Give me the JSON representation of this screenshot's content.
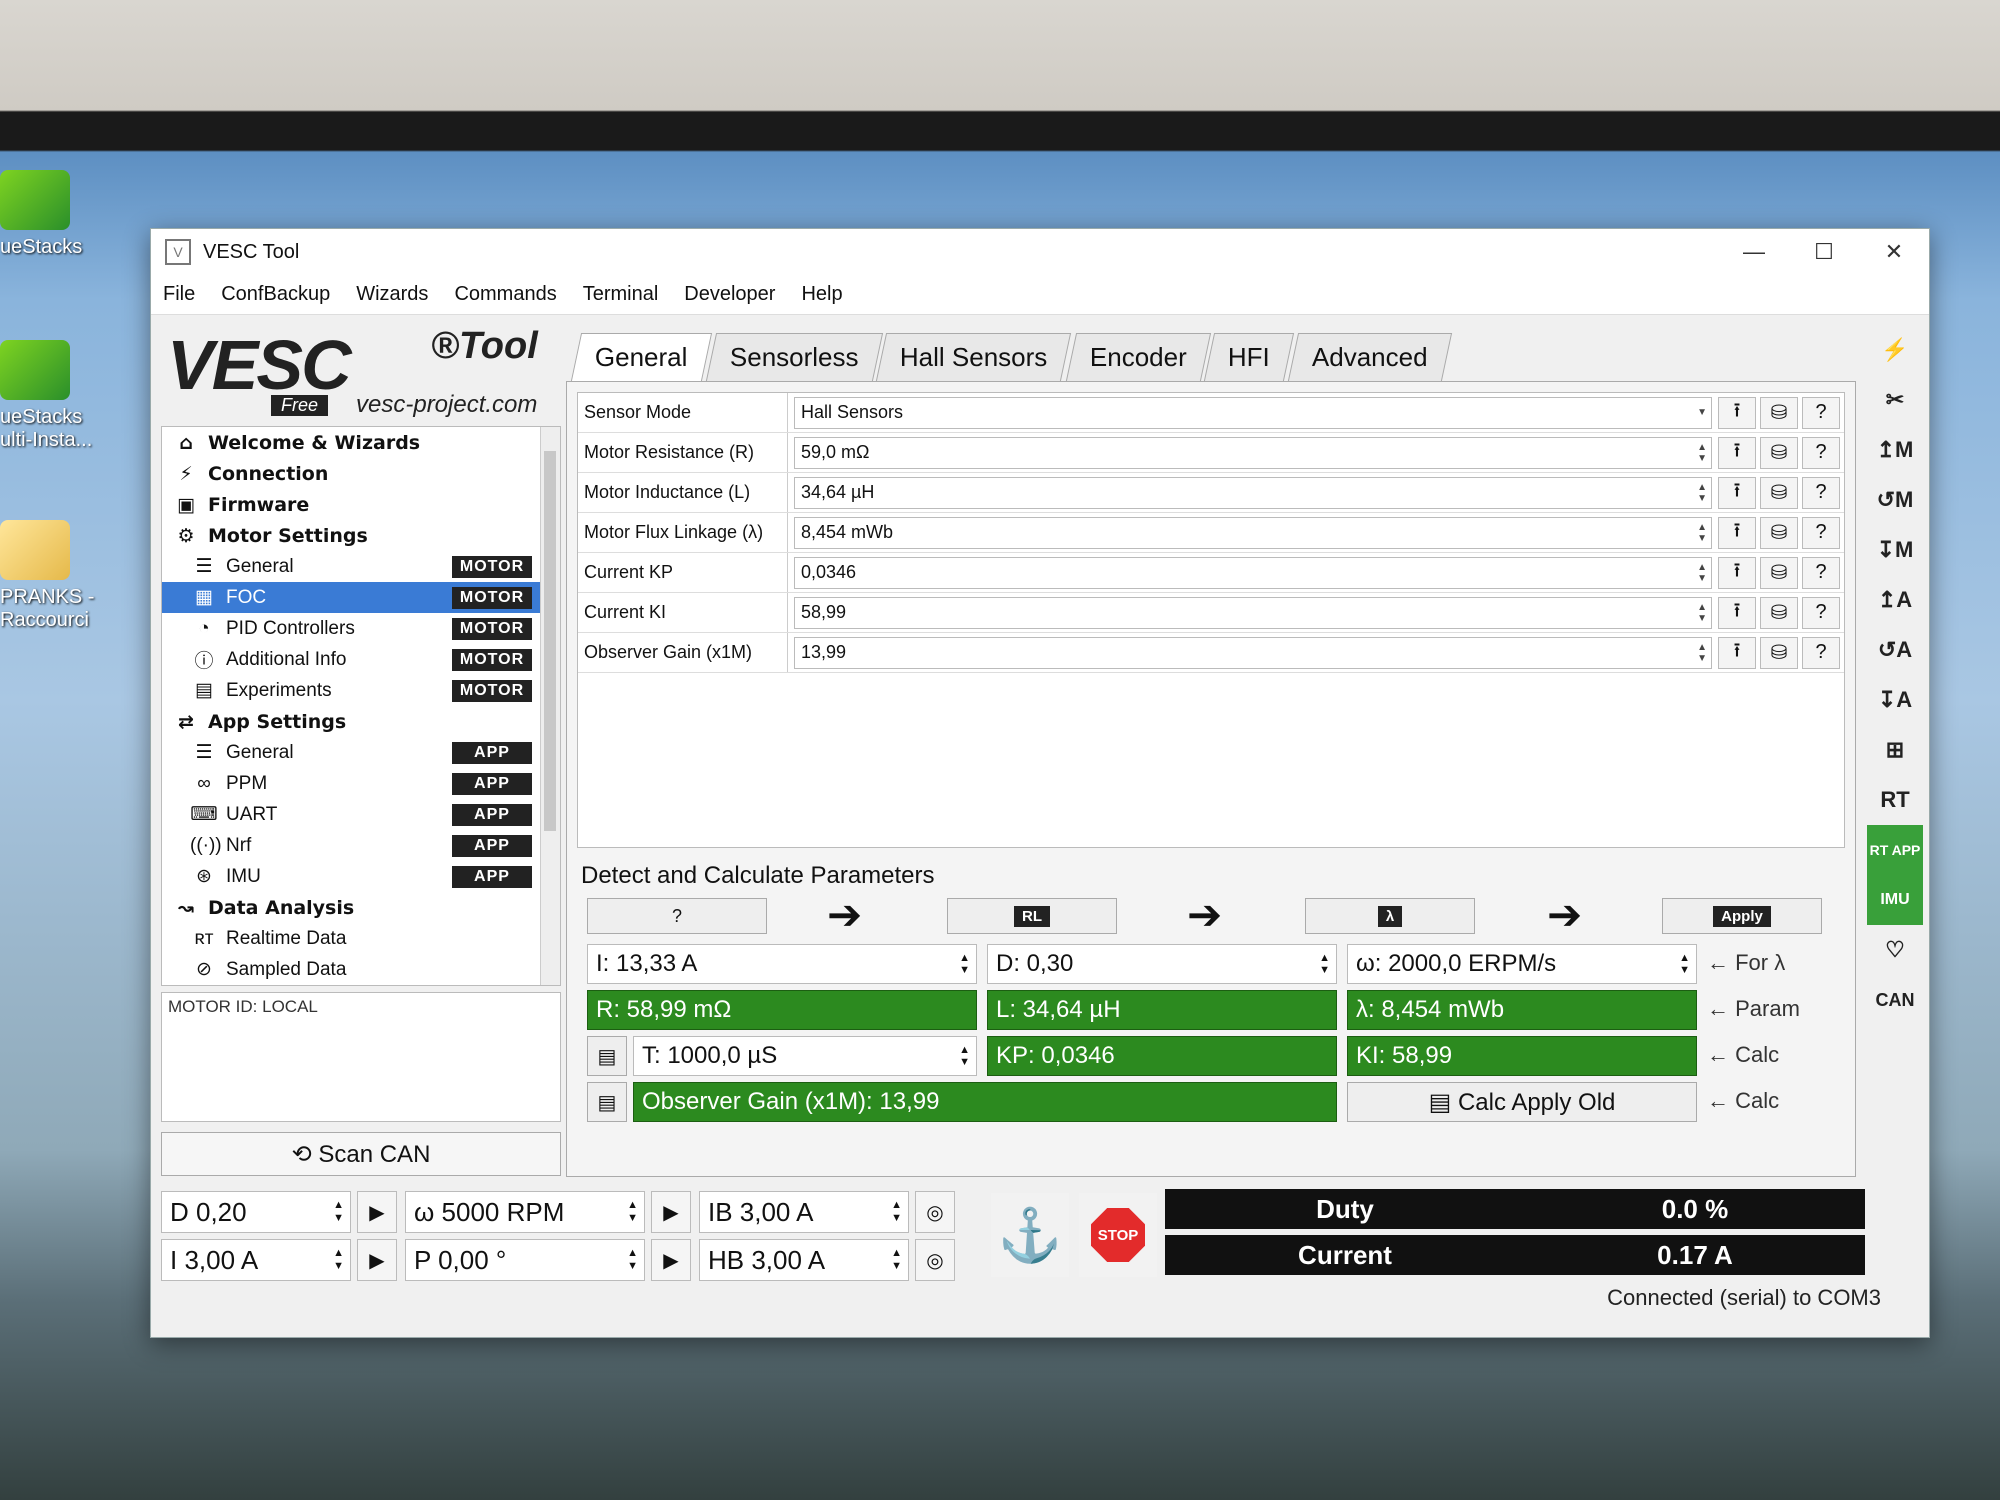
{
  "desktop": {
    "icons": [
      {
        "label": "ueStacks"
      },
      {
        "label": "ueStacks ulti-Insta..."
      },
      {
        "label": "PRANKS - Raccourci"
      }
    ]
  },
  "window": {
    "title": "VESC Tool",
    "controls": {
      "minimize": "—",
      "maximize": "☐",
      "close": "✕"
    }
  },
  "menu": [
    "File",
    "ConfBackup",
    "Wizards",
    "Commands",
    "Terminal",
    "Developer",
    "Help"
  ],
  "logo": {
    "main": "VESC",
    "tool": "®Tool",
    "free": "Free",
    "site": "vesc-project.com"
  },
  "sidebar": {
    "items": [
      {
        "label": "Welcome & Wizards",
        "icon": "home-icon",
        "glyph": "⌂"
      },
      {
        "label": "Connection",
        "icon": "plug-icon",
        "glyph": "⚡"
      },
      {
        "label": "Firmware",
        "icon": "chip-icon",
        "glyph": "▣"
      },
      {
        "label": "Motor Settings",
        "icon": "gear-icon",
        "glyph": "⚙"
      },
      {
        "label": "General",
        "icon": "sliders-icon",
        "glyph": "☰",
        "tag": "MOTOR"
      },
      {
        "label": "FOC",
        "icon": "foc-icon",
        "glyph": "▦",
        "tag": "MOTOR"
      },
      {
        "label": "PID Controllers",
        "icon": "gauge-icon",
        "glyph": "◔",
        "tag": "MOTOR"
      },
      {
        "label": "Additional Info",
        "icon": "info-icon",
        "glyph": "ⓘ",
        "tag": "MOTOR"
      },
      {
        "label": "Experiments",
        "icon": "calculator-icon",
        "glyph": "▤",
        "tag": "MOTOR"
      },
      {
        "label": "App Settings",
        "icon": "app-settings-icon",
        "glyph": "⇄"
      },
      {
        "label": "General",
        "icon": "sliders-icon",
        "glyph": "☰",
        "tag": "APP"
      },
      {
        "label": "PPM",
        "icon": "ppm-icon",
        "glyph": "∞",
        "tag": "APP"
      },
      {
        "label": "UART",
        "icon": "keyboard-icon",
        "glyph": "⌨",
        "tag": "APP"
      },
      {
        "label": "Nrf",
        "icon": "wireless-icon",
        "glyph": "((·))",
        "tag": "APP"
      },
      {
        "label": "IMU",
        "icon": "imu-icon",
        "glyph": "⊛",
        "tag": "APP"
      },
      {
        "label": "Data Analysis",
        "icon": "analysis-icon",
        "glyph": "↝"
      },
      {
        "label": "Realtime Data",
        "icon": "realtime-icon",
        "glyph": "ʀᴛ"
      },
      {
        "label": "Sampled Data",
        "icon": "sampled-icon",
        "glyph": "⊘"
      }
    ],
    "motor_id": "MOTOR ID: LOCAL",
    "scan_can": "⟲ Scan CAN"
  },
  "tabs": [
    "General",
    "Sensorless",
    "Hall Sensors",
    "Encoder",
    "HFI",
    "Advanced"
  ],
  "params": [
    {
      "label": "Sensor Mode",
      "value": "Hall Sensors",
      "type": "select"
    },
    {
      "label": "Motor Resistance (R)",
      "value": "59,0 mΩ",
      "type": "spin"
    },
    {
      "label": "Motor Inductance (L)",
      "value": "34,64 µH",
      "type": "spin"
    },
    {
      "label": "Motor Flux Linkage (λ)",
      "value": "8,454 mWb",
      "type": "spin"
    },
    {
      "label": "Current KP",
      "value": "0,0346",
      "type": "spin"
    },
    {
      "label": "Current KI",
      "value": "58,99",
      "type": "spin"
    },
    {
      "label": "Observer Gain (x1M)",
      "value": "13,99",
      "type": "spin"
    }
  ],
  "detect": {
    "title": "Detect and Calculate Parameters",
    "help_btn": "?",
    "rl_btn": "RL",
    "lambda_btn": "λ",
    "apply_btn": "Apply",
    "arrow": "➔",
    "i_input": "I: 13,33 A",
    "d_input": "D: 0,30",
    "w_input": "ω: 2000,0 ERPM/s",
    "r_result": "R: 58,99 mΩ",
    "l_result": "L: 34,64 µH",
    "lambda_result": "λ: 8,454 mWb",
    "t_input": "T: 1000,0 µS",
    "kp_result": "KP: 0,0346",
    "ki_result": "KI: 58,99",
    "observer_result": "Observer Gain (x1M): 13,99",
    "calc_apply_old": "▤ Calc Apply Old",
    "labels": [
      "← For λ",
      "← Param",
      "← Calc",
      "← Calc"
    ]
  },
  "bottom": {
    "d_value": "D 0,20",
    "i_value": "I 3,00 A",
    "rpm_value": "ω 5000 RPM",
    "p_value": "P 0,00 °",
    "ib_value": "IB 3,00 A",
    "hb_value": "HB 3,00 A",
    "stop_label": "STOP",
    "duty_label": "Duty",
    "duty_value": "0.0 %",
    "current_label": "Current",
    "current_value": "0.17 A",
    "status": "Connected (serial) to COM3"
  },
  "right_toolbar": [
    {
      "icon": "connect-icon",
      "glyph": "⚡"
    },
    {
      "icon": "disconnect-icon",
      "glyph": "✂"
    },
    {
      "icon": "read-motor-icon",
      "glyph": "↥M"
    },
    {
      "icon": "default-motor-icon",
      "glyph": "↺M"
    },
    {
      "icon": "write-motor-icon",
      "glyph": "↧M"
    },
    {
      "icon": "read-app-icon",
      "glyph": "↥A"
    },
    {
      "icon": "default-app-icon",
      "glyph": "↺A"
    },
    {
      "icon": "write-app-icon",
      "glyph": "↧A"
    },
    {
      "icon": "can-network-icon",
      "glyph": "⊞"
    },
    {
      "icon": "realtime-data-icon",
      "glyph": "RT"
    },
    {
      "icon": "realtime-app-icon",
      "glyph": "RT APP"
    },
    {
      "icon": "imu-data-icon",
      "glyph": "IMU"
    },
    {
      "icon": "heart-icon",
      "glyph": "♡"
    },
    {
      "icon": "can-forward-icon",
      "glyph": "CAN"
    }
  ]
}
